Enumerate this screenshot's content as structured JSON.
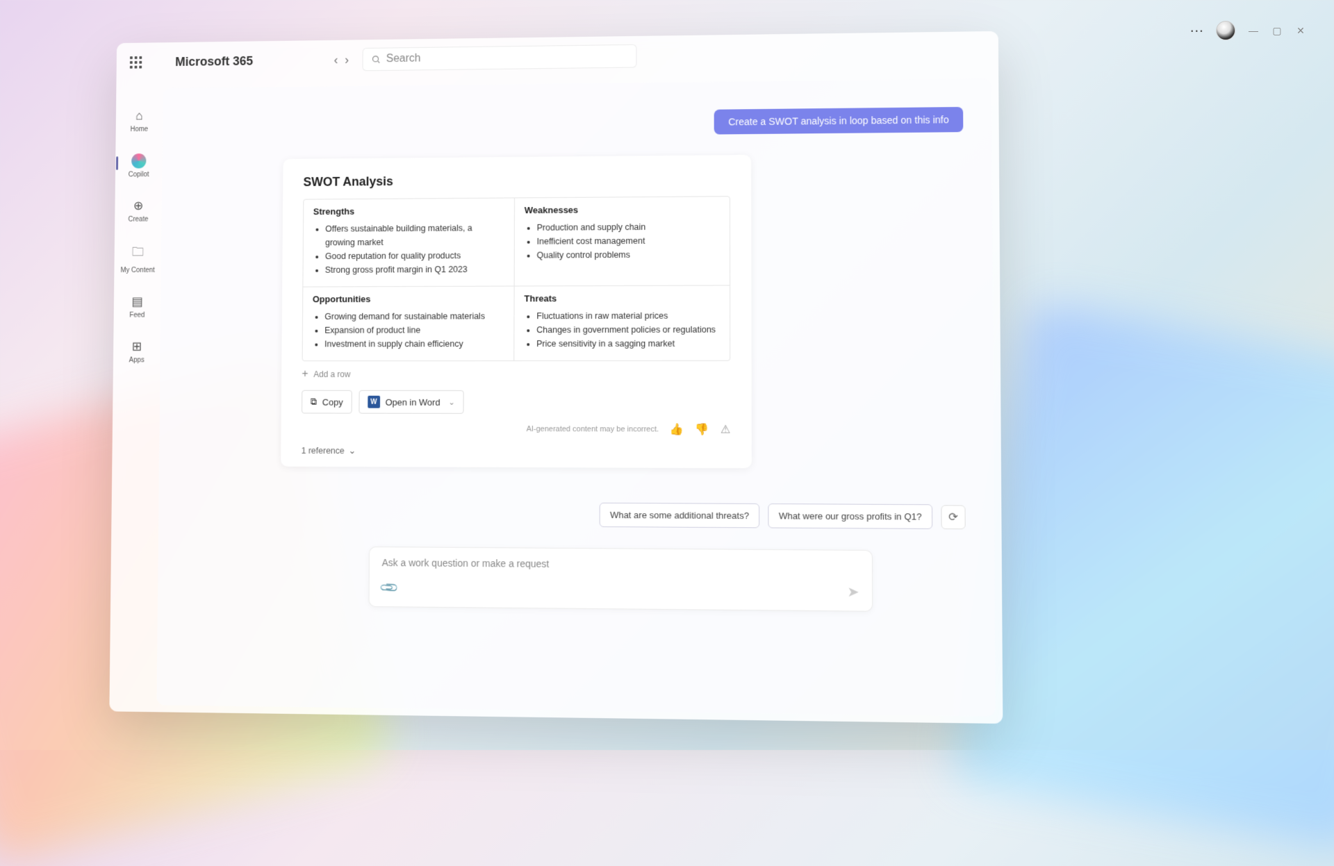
{
  "header": {
    "app_title": "Microsoft 365",
    "search_placeholder": "Search"
  },
  "sidebar": {
    "items": [
      {
        "label": "Home"
      },
      {
        "label": "Copilot"
      },
      {
        "label": "Create"
      },
      {
        "label": "My Content"
      },
      {
        "label": "Feed"
      },
      {
        "label": "Apps"
      }
    ]
  },
  "chat": {
    "user_prompt": "Create a SWOT analysis in loop based on this info",
    "response": {
      "title": "SWOT Analysis",
      "quadrants": {
        "strengths": {
          "heading": "Strengths",
          "items": [
            "Offers sustainable building materials, a growing market",
            "Good reputation for quality products",
            "Strong gross profit margin in Q1 2023"
          ]
        },
        "weaknesses": {
          "heading": "Weaknesses",
          "items": [
            "Production and supply chain",
            "Inefficient cost management",
            "Quality control problems"
          ]
        },
        "opportunities": {
          "heading": "Opportunities",
          "items": [
            "Growing demand for sustainable materials",
            "Expansion of product line",
            "Investment in supply chain efficiency"
          ]
        },
        "threats": {
          "heading": "Threats",
          "items": [
            "Fluctuations in raw material prices",
            "Changes in government policies or regulations",
            "Price sensitivity in a sagging market"
          ]
        }
      },
      "add_row_label": "Add a row",
      "copy_label": "Copy",
      "open_word_label": "Open in Word",
      "ai_disclaimer": "AI-generated content may be incorrect.",
      "references_label": "1 reference"
    },
    "suggestions": [
      "What are some additional threats?",
      "What were our gross profits in Q1?"
    ],
    "input_placeholder": "Ask a work question or make a request"
  }
}
